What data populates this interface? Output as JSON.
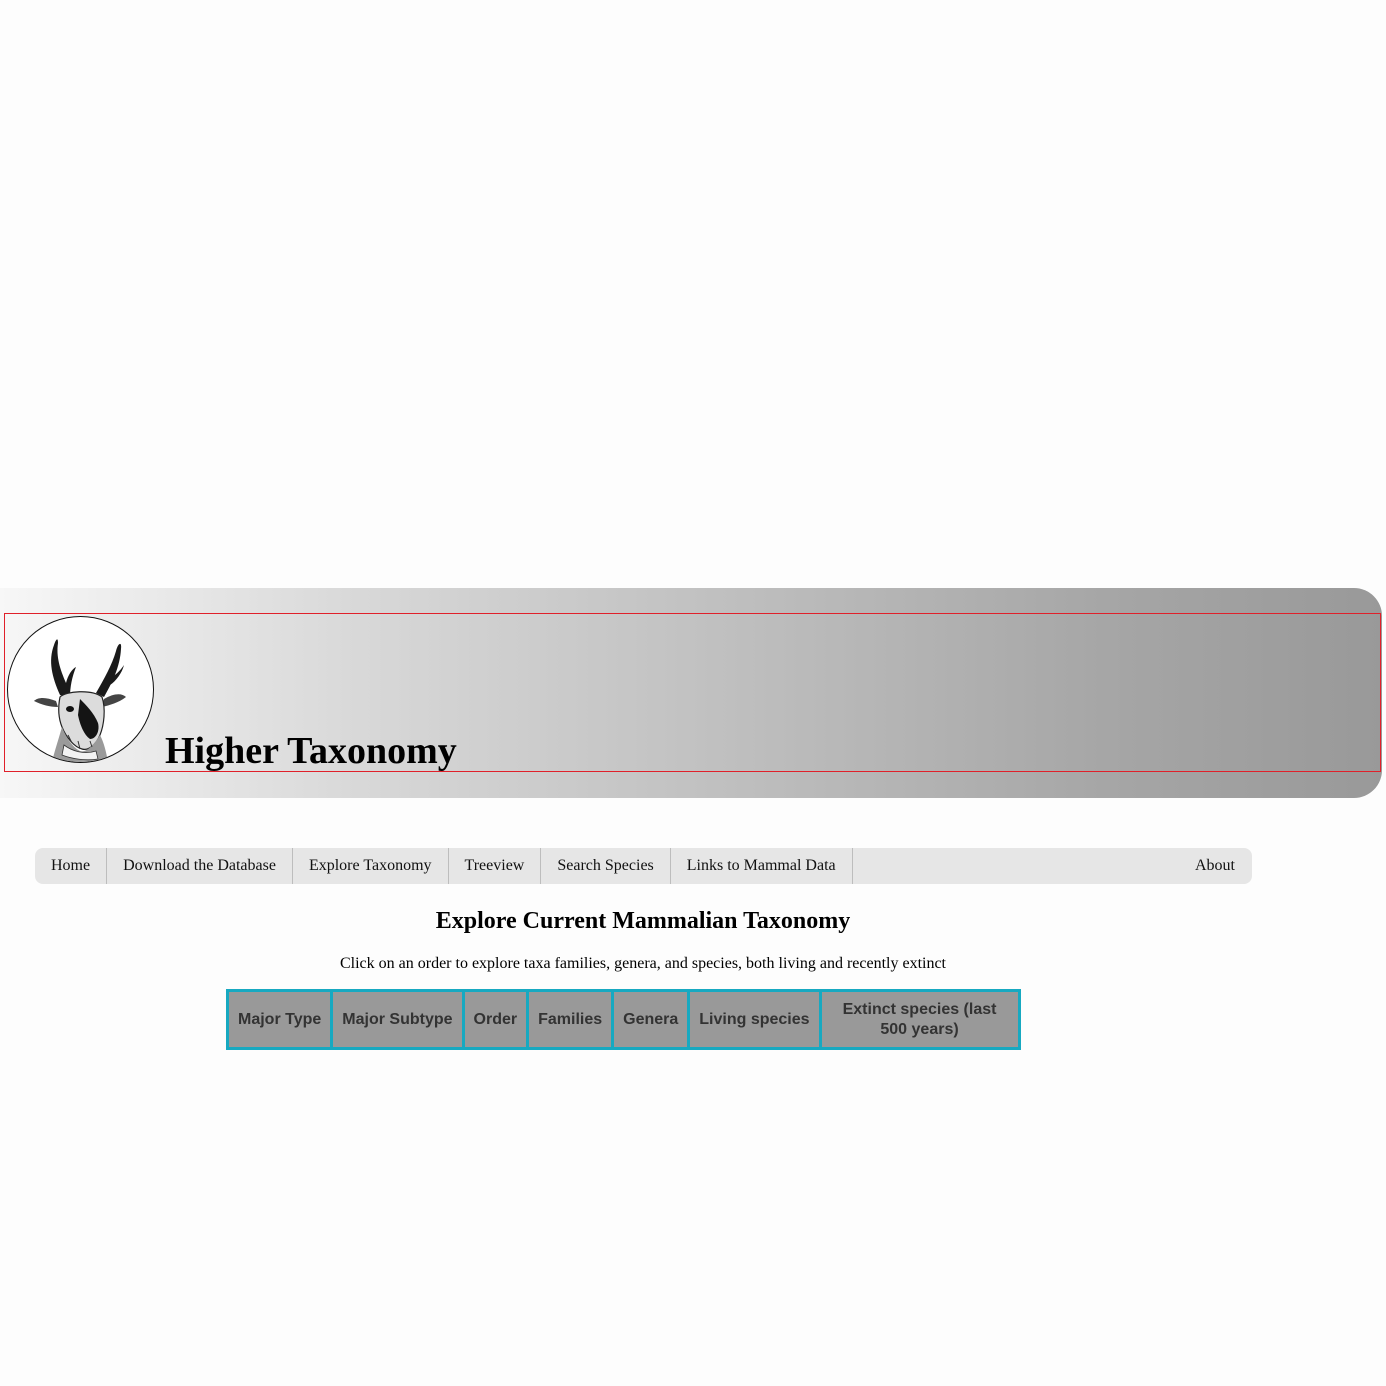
{
  "header": {
    "title": "Higher Taxonomy",
    "logo_icon": "pronghorn-antelope-logo"
  },
  "nav": {
    "items": [
      {
        "label": "Home"
      },
      {
        "label": "Download the Database"
      },
      {
        "label": "Explore Taxonomy"
      },
      {
        "label": "Treeview"
      },
      {
        "label": "Search Species"
      },
      {
        "label": "Links to Mammal Data"
      }
    ],
    "about_label": "About"
  },
  "main": {
    "heading": "Explore Current Mammalian Taxonomy",
    "subtitle": "Click on an order to explore taxa families, genera, and species, both living and recently extinct",
    "table": {
      "headers": [
        "Major Type",
        "Major Subtype",
        "Order",
        "Families",
        "Genera",
        "Living species",
        "Extinct species (last 500 years)"
      ]
    }
  },
  "colors": {
    "table_header_bg": "#999999",
    "table_border": "#17a9c1",
    "banner_frame": "#e0202a",
    "nav_bg": "#e6e6e6"
  }
}
